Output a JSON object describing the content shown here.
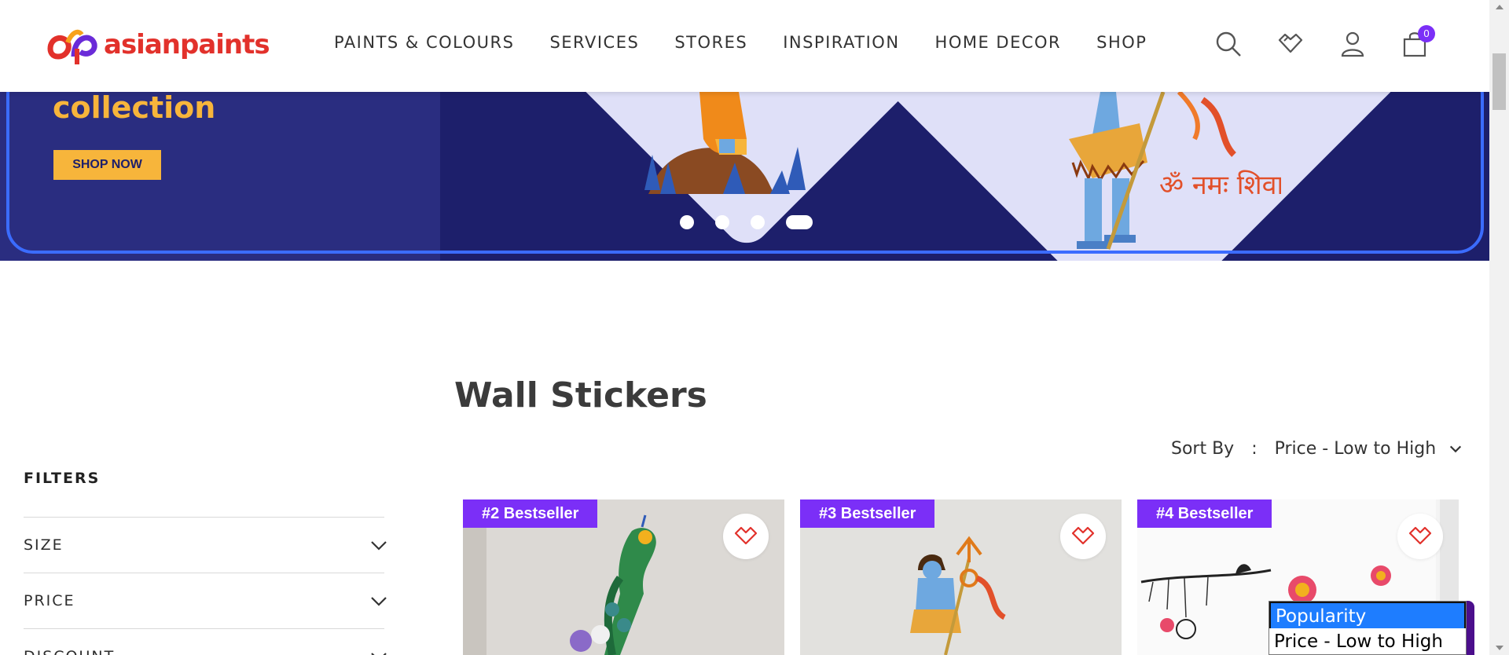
{
  "brand": {
    "name": "asianpaints"
  },
  "nav": {
    "items": [
      "PAINTS & COLOURS",
      "SERVICES",
      "STORES",
      "INSPIRATION",
      "HOME DECOR",
      "SHOP"
    ]
  },
  "header_icons": {
    "search": "search-icon",
    "wishlist": "heart-icon",
    "account": "user-icon",
    "cart": "cart-icon",
    "cart_count": "0"
  },
  "banner": {
    "title": "collection",
    "cta": "SHOP NOW",
    "slides": 4,
    "active_slide": 4,
    "devanagari": "ॐ नमः शिवाय"
  },
  "filters": {
    "title": "FILTERS",
    "groups": [
      "SIZE",
      "PRICE",
      "DISCOUNT"
    ]
  },
  "listing": {
    "title": "Wall Stickers",
    "sort_label": "Sort By",
    "sort_colon": ":",
    "sort_value": "Price - Low to High",
    "sort_options": [
      "Popularity",
      "Price - Low to High"
    ],
    "products": [
      {
        "badge": "#2 Bestseller"
      },
      {
        "badge": "#3 Bestseller"
      },
      {
        "badge": "#4 Bestseller"
      }
    ]
  },
  "colors": {
    "brand_red": "#e2312b",
    "accent_purple": "#7b2ff7",
    "banner_navy": "#1d1f6b",
    "cta_yellow": "#f7b53b"
  }
}
